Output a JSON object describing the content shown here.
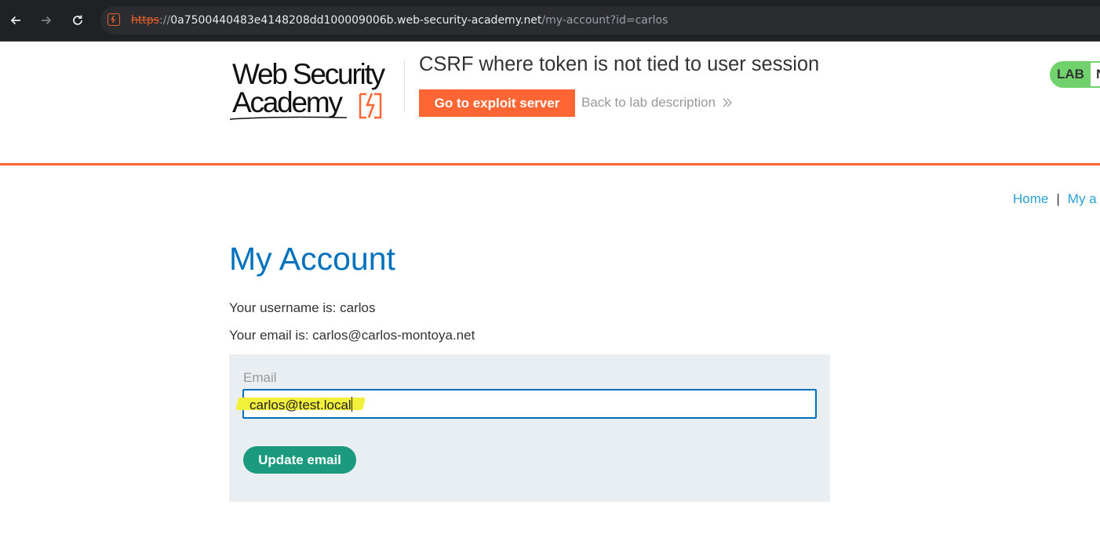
{
  "browser": {
    "url_scheme": "https",
    "url_separator": "://",
    "url_host": "0a7500440483e4148208dd100009006b.web-security-academy.net",
    "url_path": "/my-account?id=carlos"
  },
  "header": {
    "logo_line1": "Web Security",
    "logo_line2": "Academy",
    "lab_title": "CSRF where token is not tied to user session",
    "exploit_button": "Go to exploit server",
    "back_link": "Back to lab description",
    "lab_badge": "LAB",
    "lab_badge_cut": "N"
  },
  "nav": {
    "home": "Home",
    "separator": "|",
    "my_account": "My a"
  },
  "main": {
    "title": "My Account",
    "username_line": "Your username is: carlos",
    "email_line": "Your email is: carlos@carlos-montoya.net",
    "form": {
      "email_label": "Email",
      "email_value": "carlos@test.local",
      "submit_label": "Update email"
    }
  },
  "colors": {
    "accent": "#ff6633",
    "title_blue": "#0071bc",
    "link_blue": "#29a0d7",
    "button_green": "#1b9a80",
    "badge_green": "#70d16d",
    "highlight": "#f2f03a"
  }
}
